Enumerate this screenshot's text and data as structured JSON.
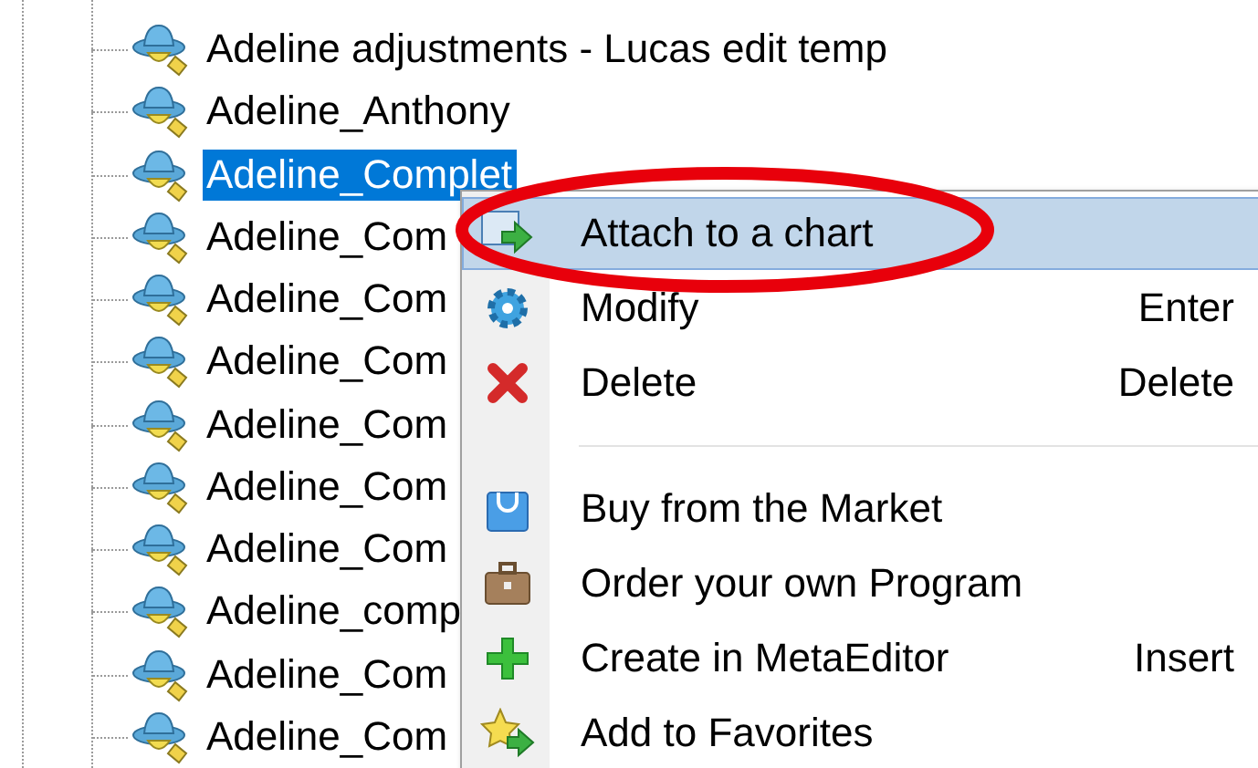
{
  "tree": {
    "items": [
      {
        "label": "Adeline adjustments - Lucas edit temp",
        "selected": false
      },
      {
        "label": "Adeline_Anthony",
        "selected": false
      },
      {
        "label": "Adeline_Complet",
        "selected": true
      },
      {
        "label": "Adeline_Com",
        "selected": false
      },
      {
        "label": "Adeline_Com",
        "selected": false
      },
      {
        "label": "Adeline_Com",
        "selected": false
      },
      {
        "label": "Adeline_Com",
        "selected": false
      },
      {
        "label": "Adeline_Com",
        "selected": false
      },
      {
        "label": "Adeline_Com",
        "selected": false
      },
      {
        "label": "Adeline_comp",
        "selected": false
      },
      {
        "label": "Adeline_Com",
        "selected": false
      },
      {
        "label": "Adeline_Com",
        "selected": false
      }
    ]
  },
  "context_menu": {
    "sections": [
      [
        {
          "label": "Attach to a chart",
          "selected": true
        },
        {
          "label": "Modify",
          "shortcut": "Enter",
          "selected": false
        },
        {
          "label": "Delete",
          "shortcut": "Delete",
          "selected": false
        }
      ],
      [
        {
          "label": "Buy from the Market",
          "selected": false
        },
        {
          "label": "Order your own Program",
          "selected": false
        },
        {
          "label": "Create in MetaEditor",
          "shortcut": "Insert",
          "selected": false
        },
        {
          "label": "Add to Favorites",
          "selected": false
        }
      ]
    ]
  }
}
